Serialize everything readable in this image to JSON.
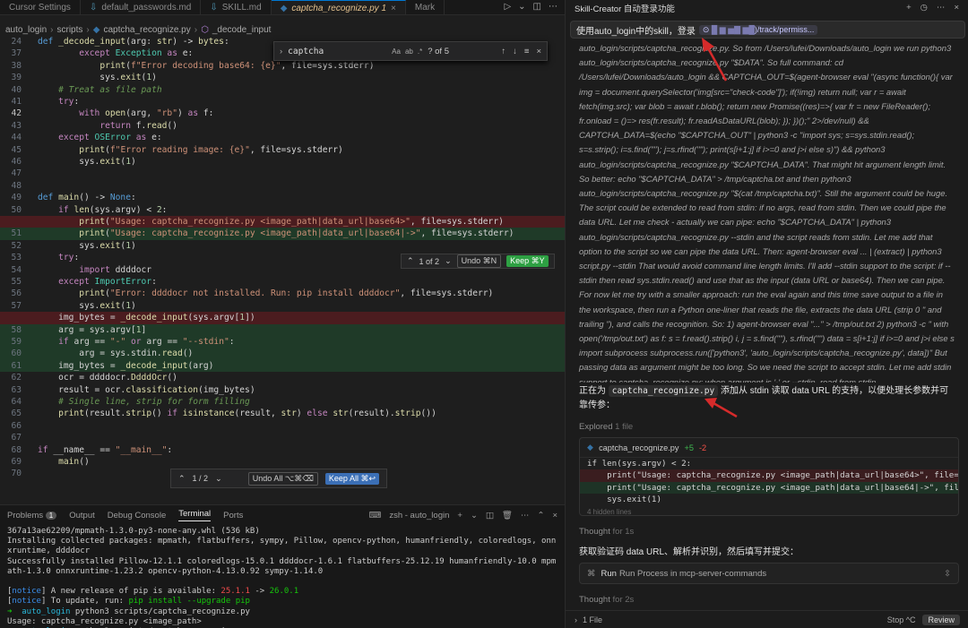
{
  "tabs": [
    {
      "label": "Cursor Settings",
      "active": false
    },
    {
      "label": "default_passwords.md",
      "active": false
    },
    {
      "label": "SKILL.md",
      "active": false
    },
    {
      "label": "captcha_recognize.py 1",
      "active": true
    },
    {
      "label": "Mark",
      "active": false
    }
  ],
  "breadcrumb": [
    "auto_login",
    "scripts",
    "captcha_recognize.py",
    "_decode_input"
  ],
  "find": {
    "query": "captcha",
    "count": "? of 5"
  },
  "diffbar1": {
    "count": "1 of 2",
    "undo": "Undo ⌘N",
    "keep": "Keep ⌘Y"
  },
  "diffbar2": {
    "count": "1 / 2",
    "undo_all": "Undo All ⌥⌘⌫",
    "keep_all": "Keep All ⌘↩"
  },
  "code_lines": [
    {
      "n": "24",
      "t": "def _decode_input(arg: str) -> bytes:"
    },
    {
      "n": "37",
      "t": "        except Exception as e:"
    },
    {
      "n": "38",
      "t": "            print(f\"Error decoding base64: {e}\", file=sys.stderr)"
    },
    {
      "n": "39",
      "t": "            sys.exit(1)"
    },
    {
      "n": "40",
      "t": "    # Treat as file path"
    },
    {
      "n": "41",
      "t": "    try:"
    },
    {
      "n": "42",
      "t": "        with open(arg, \"rb\") as f:"
    },
    {
      "n": "43",
      "t": "            return f.read()"
    },
    {
      "n": "44",
      "t": "    except OSError as e:"
    },
    {
      "n": "45",
      "t": "        print(f\"Error reading image: {e}\", file=sys.stderr)"
    },
    {
      "n": "46",
      "t": "        sys.exit(1)"
    },
    {
      "n": "47",
      "t": ""
    },
    {
      "n": "48",
      "t": ""
    },
    {
      "n": "49",
      "t": "def main() -> None:"
    },
    {
      "n": "50",
      "t": "    if len(sys.argv) < 2:"
    },
    {
      "n": "",
      "t": "        print(\"Usage: captcha_recognize.py <image_path|data_url|base64>\", file=sys.stderr)"
    },
    {
      "n": "51",
      "t": "        print(\"Usage: captcha_recognize.py <image_path|data_url|base64|->\", file=sys.stderr)"
    },
    {
      "n": "52",
      "t": "        sys.exit(1)"
    },
    {
      "n": "53",
      "t": "    try:"
    },
    {
      "n": "54",
      "t": "        import ddddocr"
    },
    {
      "n": "55",
      "t": "    except ImportError:"
    },
    {
      "n": "56",
      "t": "        print(\"Error: ddddocr not installed. Run: pip install ddddocr\", file=sys.stderr)"
    },
    {
      "n": "57",
      "t": "        sys.exit(1)"
    },
    {
      "n": "",
      "t": "    img_bytes = _decode_input(sys.argv[1])"
    },
    {
      "n": "58",
      "t": "    arg = sys.argv[1]"
    },
    {
      "n": "59",
      "t": "    if arg == \"-\" or arg == \"--stdin\":"
    },
    {
      "n": "60",
      "t": "        arg = sys.stdin.read()"
    },
    {
      "n": "61",
      "t": "    img_bytes = _decode_input(arg)"
    },
    {
      "n": "62",
      "t": "    ocr = ddddocr.DdddOcr()"
    },
    {
      "n": "63",
      "t": "    result = ocr.classification(img_bytes)"
    },
    {
      "n": "64",
      "t": "    # Single line, strip for form filling"
    },
    {
      "n": "65",
      "t": "    print(result.strip() if isinstance(result, str) else str(result).strip())"
    },
    {
      "n": "66",
      "t": ""
    },
    {
      "n": "67",
      "t": ""
    },
    {
      "n": "68",
      "t": "if __name__ == \"__main__\":"
    },
    {
      "n": "69",
      "t": "    main()"
    },
    {
      "n": "70",
      "t": ""
    }
  ],
  "panel": {
    "tabs": [
      "Problems",
      "Output",
      "Debug Console",
      "Terminal",
      "Ports"
    ],
    "problems_count": "1",
    "shell": "zsh - auto_login",
    "terminal": [
      "367a13ae62209/mpmath-1.3.0-py3-none-any.whl (536 kB)",
      "Installing collected packages: mpmath, flatbuffers, sympy, Pillow, opencv-python, humanfriendly, coloredlogs, onnxruntime, ddddocr",
      "Successfully installed Pillow-12.1.1 coloredlogs-15.0.1 ddddocr-1.6.1 flatbuffers-25.12.19 humanfriendly-10.0 mpmath-1.3.0 onnxruntime-1.23.2 opencv-python-4.13.0.92 sympy-1.14.0",
      "",
      "[notice] A new release of pip is available: 25.1.1 -> 26.0.1",
      "[notice] To update, run: pip install --upgrade pip",
      "➜  auto_login python3 scripts/captcha_recognize.py",
      "Usage: captcha_recognize.py <image_path>",
      "➜  auto_login python3 scripts/captcha_recognize.py"
    ]
  },
  "chat": {
    "title": "Skill-Creator 自动登录功能",
    "prompt": "使用auto_login中的skill，登录",
    "prompt_chip": ")/track/permiss...",
    "thought": "auto_login/scripts/captcha_recognize.py. So from /Users/lufei/Downloads/auto_login we run python3 auto_login/scripts/captcha_recognize.py \"$DATA\". So full command: cd /Users/lufei/Downloads/auto_login && CAPTCHA_OUT=$(agent-browser eval \"(async function(){ var img = document.querySelector('img[src=\"check-code\"]'); if(!img) return null; var r = await fetch(img.src); var blob = await r.blob(); return new Promise((res)=>{ var fr = new FileReader(); fr.onload = ()=> res(fr.result); fr.readAsDataURL(blob); }); })();\" 2>/dev/null) && CAPTCHA_DATA=$(echo \"$CAPTCHA_OUT\" | python3 -c \"import sys; s=sys.stdin.read(); s=s.strip(); i=s.find('\"'); j=s.rfind('\"'); print(s[i+1:j] if i>=0 and j>i else s)\") && python3 auto_login/scripts/captcha_recognize.py \"$CAPTCHA_DATA\". That might hit argument length limit. So better: echo \"$CAPTCHA_DATA\" > /tmp/captcha.txt and then python3 auto_login/scripts/captcha_recognize.py \"$(cat /tmp/captcha.txt)\". Still the argument could be huge. The script could be extended to read from stdin: if no args, read from stdin. Then we could pipe the data URL. Let me check - actually we can pipe: echo \"$CAPTCHA_DATA\" | python3 auto_login/scripts/captcha_recognize.py --stdin and the script reads from stdin. Let me add that option to the script so we can pipe the data URL. Then: agent-browser eval ... | (extract) | python3 script.py --stdin That would avoid command line length limits. I'll add --stdin support to the script: if --stdin then read sys.stdin.read() and use that as the input (data URL or base64). Then we can pipe. For now let me try with a smaller approach: run the eval again and this time save output to a file in the workspace, then run a Python one-liner that reads the file, extracts the data URL (strip 0 \" and trailing \"), and calls the recognition. So: 1) agent-browser eval \"...\" > /tmp/out.txt 2) python3 -c \" with open('/tmp/out.txt') as f: s = f.read().strip() i, j = s.find('\"'), s.rfind('\"') data = s[i+1:j] if i>=0 and j>i else s import subprocess subprocess.run(['python3', 'auto_login/scripts/captcha_recognize.py', data])\" But passing data as argument might be too long. So we need the script to accept stdin. Let me add stdin support to captcha_recognize.py: when argument is '-' or --stdin, read from stdin.",
    "status_pre": "正在为",
    "status_code": "captcha_recognize.py",
    "status_post": "添加从 stdin 读取 data URL 的支持，以便处理长参数并可靠传参：",
    "explored": "Explored",
    "explored_count": "1 file",
    "diff_file": "captcha_recognize.py",
    "diff_add": "+5",
    "diff_del": "-2",
    "diff_lines": [
      "if len(sys.argv) < 2:",
      "    print(\"Usage: captcha_recognize.py <image_path|data_url|base64>\", file=sy",
      "    print(\"Usage: captcha_recognize.py <image_path|data_url|base64|->\", file=",
      "    sys.exit(1)",
      "4 hidden lines"
    ],
    "thought1": "Thought",
    "thought1_time": "for 1s",
    "step_text": "获取验证码 data URL、解析并识别，然后填写并提交：",
    "run_label": "Run",
    "run_text": "Run Process in mcp-server-commands",
    "thought2": "Thought",
    "thought2_time": "for 2s",
    "footer_files": "1 File",
    "stop": "Stop ^C",
    "review": "Review"
  }
}
